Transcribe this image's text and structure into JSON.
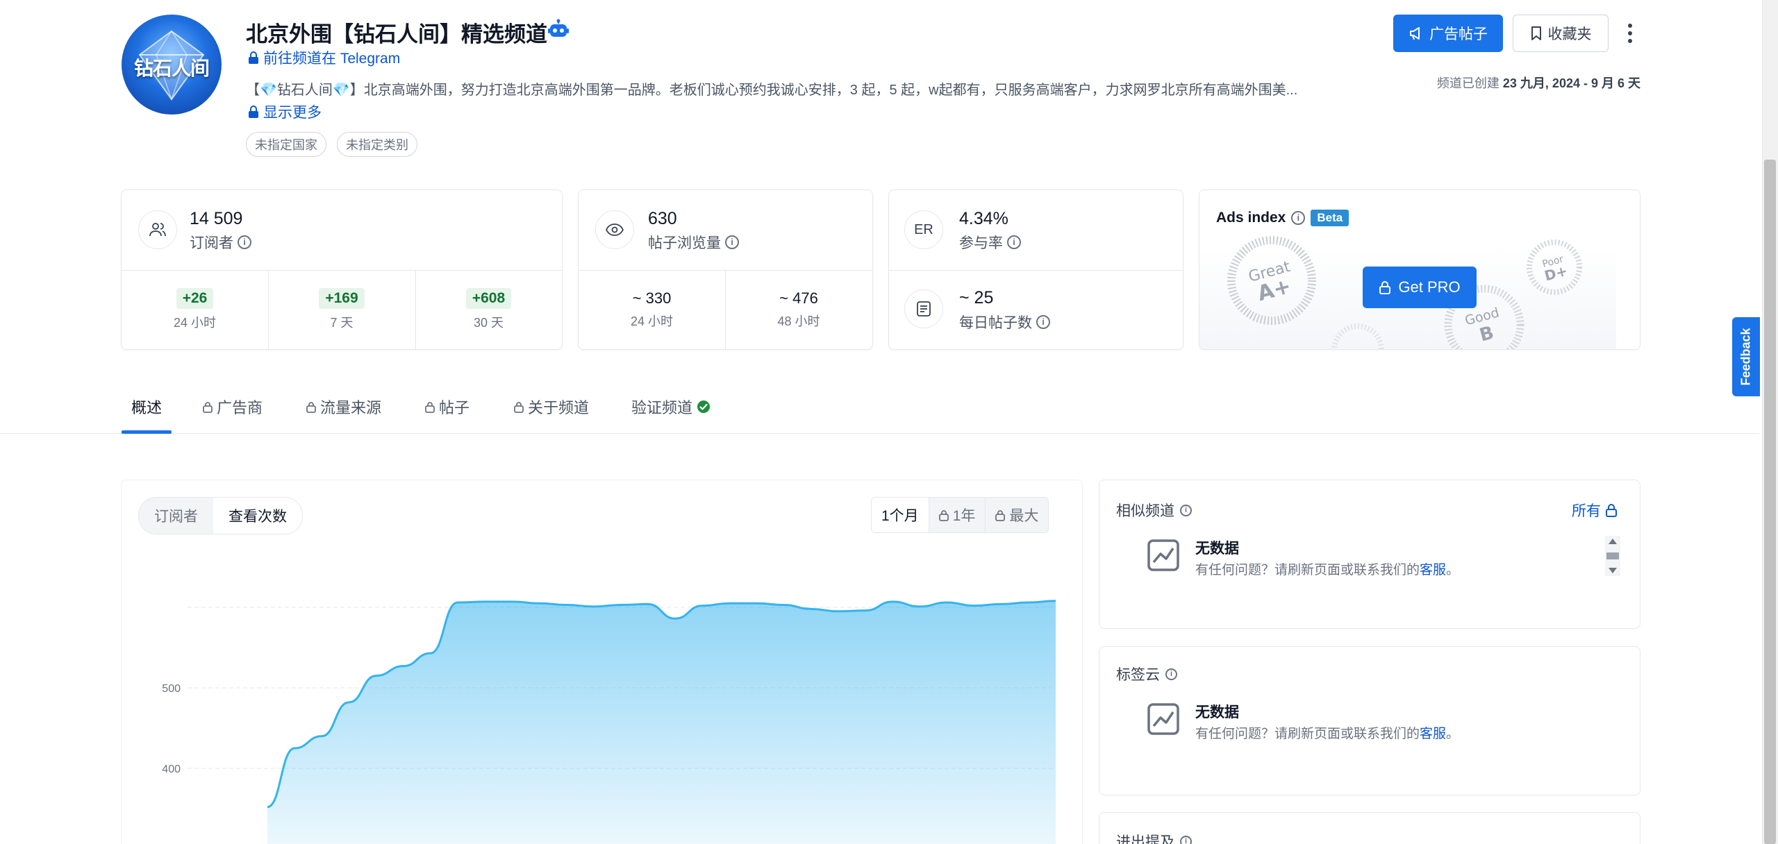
{
  "channel": {
    "title": "北京外围【钻石人间】精选频道",
    "avatar_text": "钻石人间",
    "telegram_link": "前往频道在 Telegram",
    "description": "【💎钻石人间💎】北京高端外围，努力打造北京高端外围第一品牌。老板们诚心预约我诚心安排，3 起，5 起，w起都有，只服务高端客户，力求网罗北京所有高端外围美...",
    "show_more": "显示更多",
    "tags": [
      "未指定国家",
      "未指定类别"
    ],
    "created_prefix": "频道已创建",
    "created_range": "23 九月, 2024 - 9 月 6 天"
  },
  "header_buttons": {
    "ad_posts": "广告帖子",
    "favorites": "收藏夹"
  },
  "stats": {
    "subscribers": {
      "value": "14 509",
      "label": "订阅者",
      "periods": [
        {
          "delta": "+26",
          "label": "24 小时"
        },
        {
          "delta": "+169",
          "label": "7 天"
        },
        {
          "delta": "+608",
          "label": "30 天"
        }
      ]
    },
    "views": {
      "value": "630",
      "label": "帖子浏览量",
      "periods": [
        {
          "value": "~ 330",
          "label": "24 小时"
        },
        {
          "value": "~ 476",
          "label": "48 小时"
        }
      ]
    },
    "er": {
      "icon_text": "ER",
      "value": "4.34%",
      "label": "参与率",
      "daily_value": "~ 25",
      "daily_label": "每日帖子数"
    },
    "ads_index": {
      "title": "Ads index",
      "beta": "Beta",
      "get_pro": "Get PRO",
      "grades": [
        {
          "word": "Great",
          "letter": "A+"
        },
        {
          "word": "Poor",
          "letter": "D+"
        },
        {
          "word": "Good",
          "letter": "B"
        }
      ]
    }
  },
  "tabs": [
    {
      "label": "概述",
      "locked": false,
      "active": true
    },
    {
      "label": "广告商",
      "locked": true
    },
    {
      "label": "流量来源",
      "locked": true
    },
    {
      "label": "帖子",
      "locked": true
    },
    {
      "label": "关于频道",
      "locked": true
    },
    {
      "label": "验证频道",
      "locked": false,
      "verified": true
    }
  ],
  "chart_controls": {
    "metric_toggle": [
      "订阅者",
      "查看次数"
    ],
    "active_metric": "查看次数",
    "ranges": [
      "1个月",
      "1年",
      "最大"
    ],
    "active_range": "1个月"
  },
  "chart_data": {
    "type": "area",
    "title": "",
    "xlabel": "",
    "ylabel": "",
    "y_ticks": [
      400,
      500
    ],
    "ylim": [
      350,
      640
    ],
    "x": [
      0,
      1,
      2,
      3,
      4,
      5,
      6,
      7,
      8,
      9,
      10,
      11,
      12,
      13,
      14,
      15,
      16,
      17,
      18,
      19,
      20,
      21,
      22,
      23,
      24,
      25,
      26,
      27,
      28,
      29
    ],
    "values": [
      352,
      425,
      440,
      482,
      515,
      527,
      543,
      606,
      607,
      607,
      605,
      603,
      601,
      603,
      604,
      586,
      602,
      605,
      605,
      603,
      598,
      595,
      596,
      607,
      601,
      606,
      602,
      604,
      606,
      608
    ],
    "color": "#35b3ee",
    "grid": true
  },
  "similar": {
    "title": "相似频道",
    "all_link": "所有",
    "nodata_title": "无数据",
    "nodata_sub_prefix": "有任何问题？请刷新页面或联系我们的",
    "nodata_link": "客服",
    "nodata_sub_suffix": "。"
  },
  "tagcloud": {
    "title": "标签云",
    "nodata_title": "无数据",
    "nodata_sub_prefix": "有任何问题？请刷新页面或联系我们的",
    "nodata_link": "客服",
    "nodata_sub_suffix": "。"
  },
  "mentions": {
    "title": "进出提及"
  },
  "feedback": "Feedback",
  "colors": {
    "accent": "#1a73e8",
    "link": "#0b57d0",
    "positive": "#137333",
    "chart_fill": "#35b3ee"
  }
}
